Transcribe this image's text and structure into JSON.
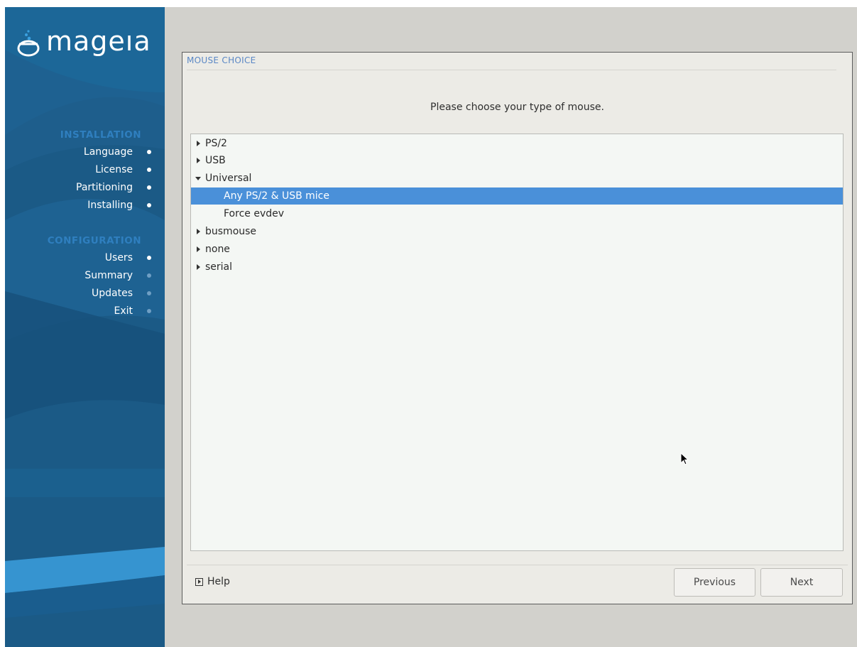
{
  "sidebar": {
    "logo_text": "mageıa",
    "sections": [
      {
        "title": "INSTALLATION",
        "items": [
          {
            "label": "Language",
            "done": true
          },
          {
            "label": "License",
            "done": true
          },
          {
            "label": "Partitioning",
            "done": true
          },
          {
            "label": "Installing",
            "done": true
          }
        ]
      },
      {
        "title": "CONFIGURATION",
        "items": [
          {
            "label": "Users",
            "done": true
          },
          {
            "label": "Summary",
            "done": false
          },
          {
            "label": "Updates",
            "done": false
          },
          {
            "label": "Exit",
            "done": false
          }
        ]
      }
    ]
  },
  "panel": {
    "title": "MOUSE CHOICE",
    "instruction": "Please choose your type of mouse."
  },
  "tree": {
    "rows": [
      {
        "label": "PS/2",
        "expander": "collapsed",
        "level": 0
      },
      {
        "label": "USB",
        "expander": "collapsed",
        "level": 0
      },
      {
        "label": "Universal",
        "expander": "expanded",
        "level": 0
      },
      {
        "label": "Any PS/2 & USB mice",
        "expander": "none",
        "level": 1,
        "selected": true
      },
      {
        "label": "Force evdev",
        "expander": "none",
        "level": 1
      },
      {
        "label": "busmouse",
        "expander": "collapsed",
        "level": 0
      },
      {
        "label": "none",
        "expander": "collapsed",
        "level": 0
      },
      {
        "label": "serial",
        "expander": "collapsed",
        "level": 0
      }
    ]
  },
  "footer": {
    "help_label": "Help",
    "previous_label": "Previous",
    "next_label": "Next"
  },
  "colors": {
    "sidebar_bg": "#1b5a86",
    "section_heading": "#2f7fbf",
    "selection": "#4a90d9",
    "title_text": "#5a87c5"
  }
}
